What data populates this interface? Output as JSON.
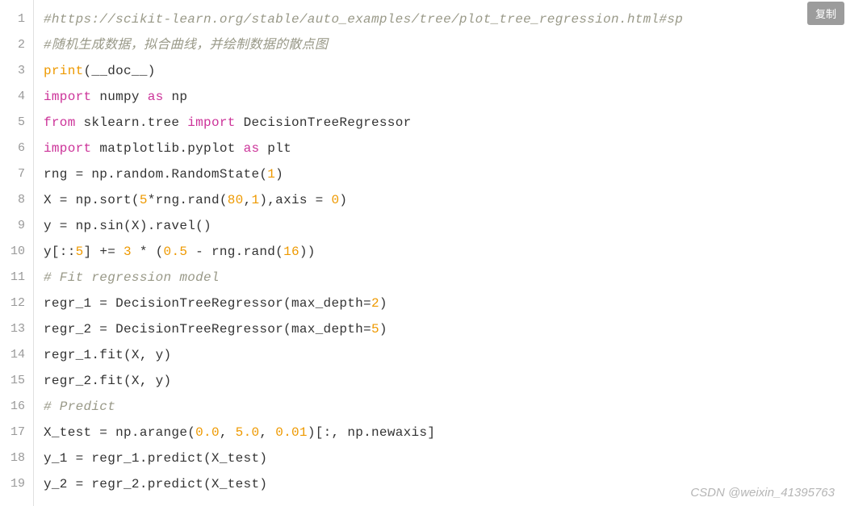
{
  "copy_button_label": "复制",
  "watermark": "CSDN @weixin_41395763",
  "line_numbers": [
    "1",
    "2",
    "3",
    "4",
    "5",
    "6",
    "7",
    "8",
    "9",
    "10",
    "11",
    "12",
    "13",
    "14",
    "15",
    "16",
    "17",
    "18",
    "19"
  ],
  "code": {
    "l1": {
      "comment": "#https://scikit-learn.org/stable/auto_examples/tree/plot_tree_regression.html#sp"
    },
    "l2": {
      "comment": "#随机生成数据，拟合曲线，并绘制数据的散点图"
    },
    "l3": {
      "fn": "print",
      "arg": "__doc__"
    },
    "l4": {
      "kw1": "import",
      "mod": "numpy",
      "kw2": "as",
      "alias": "np"
    },
    "l5": {
      "kw1": "from",
      "mod": "sklearn.tree",
      "kw2": "import",
      "name": "DecisionTreeRegressor"
    },
    "l6": {
      "kw1": "import",
      "mod": "matplotlib.pyplot",
      "kw2": "as",
      "alias": "plt"
    },
    "l7": {
      "lhs": "rng = np.random.RandomState(",
      "num": "1",
      "tail": ")"
    },
    "l8": {
      "p1": "X = np.sort(",
      "n1": "5",
      "p2": "*rng.rand(",
      "n2": "80",
      "p3": ",",
      "n3": "1",
      "p4": "),axis = ",
      "n4": "0",
      "p5": ")"
    },
    "l9": {
      "text": "y = np.sin(X).ravel()"
    },
    "l10": {
      "p1": "y[::",
      "n1": "5",
      "p2": "] += ",
      "n2": "3",
      "p3": " * (",
      "n3": "0.5",
      "p4": " - rng.rand(",
      "n4": "16",
      "p5": "))"
    },
    "l11": {
      "comment": "# Fit regression model"
    },
    "l12": {
      "p1": "regr_1 = DecisionTreeRegressor(max_depth=",
      "n1": "2",
      "p2": ")"
    },
    "l13": {
      "p1": "regr_2 = DecisionTreeRegressor(max_depth=",
      "n1": "5",
      "p2": ")"
    },
    "l14": {
      "text": "regr_1.fit(X, y)"
    },
    "l15": {
      "text": "regr_2.fit(X, y)"
    },
    "l16": {
      "comment": "# Predict"
    },
    "l17": {
      "p1": "X_test = np.arange(",
      "n1": "0.0",
      "p2": ", ",
      "n2": "5.0",
      "p3": ", ",
      "n3": "0.01",
      "p4": ")[:, np.newaxis]"
    },
    "l18": {
      "text": "y_1 = regr_1.predict(X_test)"
    },
    "l19": {
      "text": "y_2 = regr_2.predict(X_test)"
    }
  }
}
